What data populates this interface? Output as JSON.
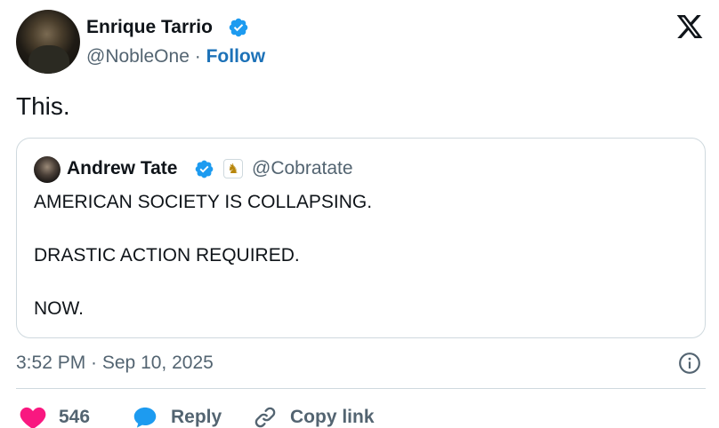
{
  "author": {
    "name": "Enrique Tarrio",
    "handle": "@NobleOne",
    "separator": "·",
    "follow_label": "Follow"
  },
  "tweet": {
    "text": "This."
  },
  "quote": {
    "name": "Andrew Tate",
    "handle": "@Cobratate",
    "badge_icon": "chess-knight-icon",
    "lines": [
      "AMERICAN SOCIETY IS COLLAPSING.",
      "DRASTIC ACTION REQUIRED.",
      "NOW."
    ]
  },
  "meta": {
    "timestamp": "3:52 PM · Sep 10, 2025"
  },
  "actions": {
    "like_count": "546",
    "reply_label": "Reply",
    "copy_label": "Copy link"
  },
  "colors": {
    "verified": "#1d9bf0",
    "follow": "#1d72b8",
    "like": "#f91880",
    "reply": "#1d9bf0",
    "muted": "#536471",
    "border": "#cfd9de"
  }
}
